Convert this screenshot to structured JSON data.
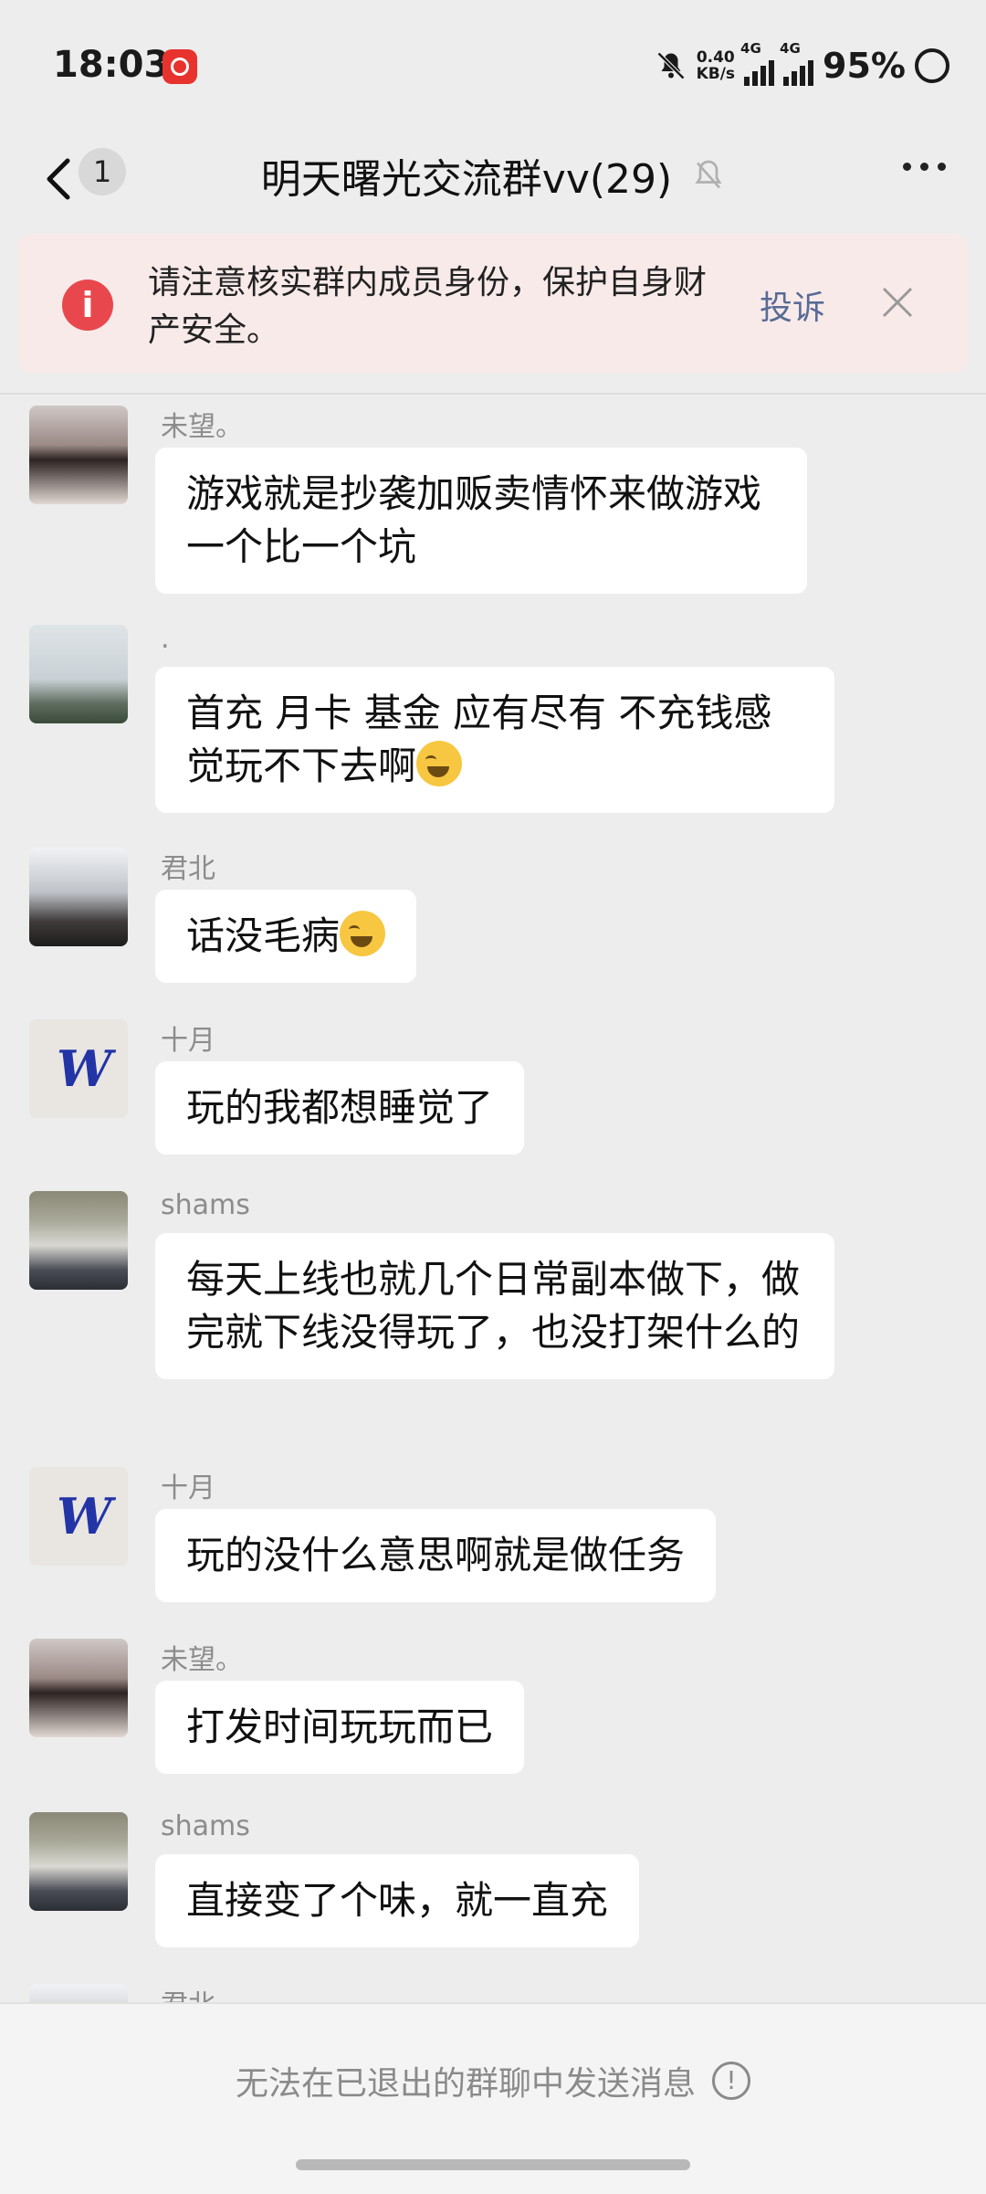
{
  "status_bar": {
    "time": "18:03",
    "net_speed_value": "0.40",
    "net_speed_unit": "KB/s",
    "signal_1": "4G",
    "signal_2": "4G",
    "battery": "95%"
  },
  "nav": {
    "unread_count": "1",
    "title": "明天曙光交流群vv(29)"
  },
  "notice": {
    "text": "请注意核实群内成员身份，保护自身财产安全。",
    "complain_label": "投诉"
  },
  "messages": [
    {
      "sender": "未望。",
      "text": "游戏就是抄袭加贩卖情怀来做游戏  一个比一个坑"
    },
    {
      "sender": ".",
      "text": "首充 月卡 基金 应有尽有 不充钱感觉玩不下去啊"
    },
    {
      "sender": "君北",
      "text": "话没毛病"
    },
    {
      "sender": "十月",
      "text": "玩的我都想睡觉了"
    },
    {
      "sender": "shams",
      "text": "每天上线也就几个日常副本做下，做完就下线没得玩了，也没打架什么的"
    },
    {
      "sender": "十月",
      "text": "玩的没什么意思啊就是做任务"
    },
    {
      "sender": "未望。",
      "text": "打发时间玩玩而已"
    },
    {
      "sender": "shams",
      "text": "直接变了个味，就一直充"
    },
    {
      "sender": "君北",
      "text": ""
    }
  ],
  "footer": {
    "text": "无法在已退出的群聊中发送消息"
  }
}
